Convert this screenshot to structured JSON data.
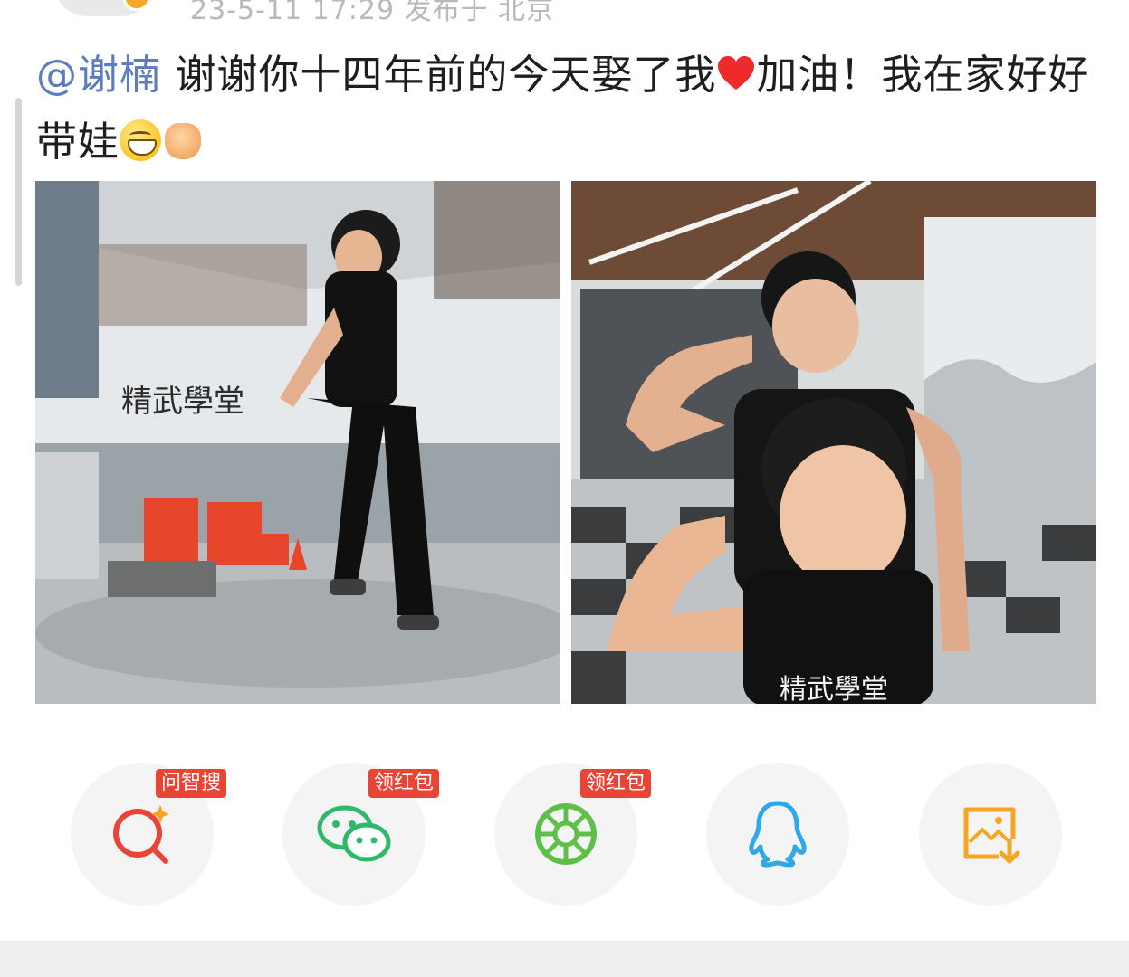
{
  "post": {
    "meta": "23-5-11 17:29  发布于 北京",
    "mention": "@谢楠",
    "text": " 谢谢你十四年前的今天娶了我",
    "text_after_heart": "加油！我在家好好带娃"
  },
  "photos": [
    {
      "name": "photo-kungfu-jump",
      "sign_text": "精武學堂"
    },
    {
      "name": "photo-two-boys-flex"
    }
  ],
  "share": {
    "items": [
      {
        "key": "ask-search",
        "badge": "问智搜",
        "icon": "ai-search-icon",
        "color": "#ea4437"
      },
      {
        "key": "wechat",
        "badge": "领红包",
        "icon": "wechat-icon",
        "color": "#2fb86a"
      },
      {
        "key": "moments",
        "badge": "领红包",
        "icon": "moments-icon",
        "color": "#5fbf4a"
      },
      {
        "key": "qq",
        "badge": "",
        "icon": "qq-icon",
        "color": "#2da9ea"
      },
      {
        "key": "save-image",
        "badge": "",
        "icon": "save-image-icon",
        "color": "#f5a623"
      }
    ]
  }
}
